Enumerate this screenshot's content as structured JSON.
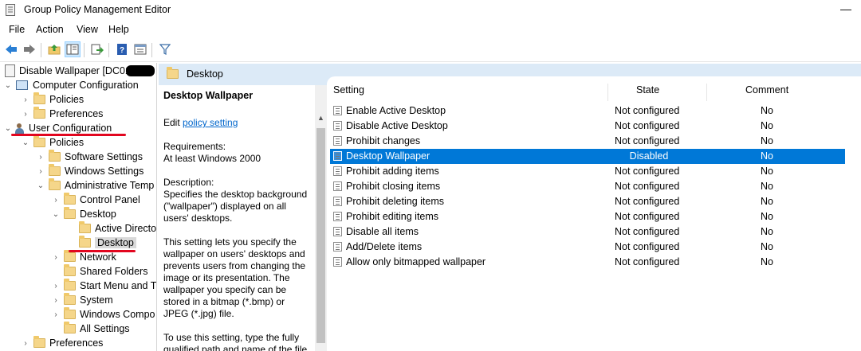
{
  "window": {
    "title": "Group Policy Management Editor",
    "minimize_glyph": "—"
  },
  "menu": [
    "File",
    "Action",
    "View",
    "Help"
  ],
  "toolbar_icons": [
    "back-arrow-icon",
    "forward-arrow-icon",
    "up-folder-icon",
    "show-hide-tree-icon",
    "export-list-icon",
    "help-icon",
    "properties-icon",
    "filter-icon"
  ],
  "tree": {
    "root": "Disable Wallpaper [DC01",
    "nodes": [
      {
        "label": "Computer Configuration"
      },
      {
        "label": "Policies"
      },
      {
        "label": "Preferences"
      },
      {
        "label": "User Configuration"
      },
      {
        "label": "Policies"
      },
      {
        "label": "Software Settings"
      },
      {
        "label": "Windows Settings"
      },
      {
        "label": "Administrative Temp"
      },
      {
        "label": "Control Panel"
      },
      {
        "label": "Desktop"
      },
      {
        "label": "Active Directo"
      },
      {
        "label": "Desktop"
      },
      {
        "label": "Network"
      },
      {
        "label": "Shared Folders"
      },
      {
        "label": "Start Menu and T"
      },
      {
        "label": "System"
      },
      {
        "label": "Windows Compo"
      },
      {
        "label": "All Settings"
      },
      {
        "label": "Preferences"
      }
    ]
  },
  "header": {
    "folder": "Desktop"
  },
  "description": {
    "title": "Desktop Wallpaper",
    "edit_prefix": "Edit",
    "edit_link": "policy setting",
    "requirements_label": "Requirements:",
    "requirements": "At least Windows 2000",
    "desc_label": "Description:",
    "desc1": "Specifies the desktop background (\"wallpaper\") displayed on all users' desktops.",
    "desc2": "This setting lets you specify the wallpaper on users' desktops and prevents users from changing the image or its presentation. The wallpaper you specify can be stored in a bitmap (*.bmp) or JPEG (*.jpg) file.",
    "desc3": "To use this setting, type the fully qualified path and name of the file"
  },
  "list": {
    "columns": [
      "Setting",
      "State",
      "Comment"
    ],
    "rows": [
      {
        "setting": "Enable Active Desktop",
        "state": "Not configured",
        "comment": "No"
      },
      {
        "setting": "Disable Active Desktop",
        "state": "Not configured",
        "comment": "No"
      },
      {
        "setting": "Prohibit changes",
        "state": "Not configured",
        "comment": "No"
      },
      {
        "setting": "Desktop Wallpaper",
        "state": "Disabled",
        "comment": "No"
      },
      {
        "setting": "Prohibit adding items",
        "state": "Not configured",
        "comment": "No"
      },
      {
        "setting": "Prohibit closing items",
        "state": "Not configured",
        "comment": "No"
      },
      {
        "setting": "Prohibit deleting items",
        "state": "Not configured",
        "comment": "No"
      },
      {
        "setting": "Prohibit editing items",
        "state": "Not configured",
        "comment": "No"
      },
      {
        "setting": "Disable all items",
        "state": "Not configured",
        "comment": "No"
      },
      {
        "setting": "Add/Delete items",
        "state": "Not configured",
        "comment": "No"
      },
      {
        "setting": "Allow only bitmapped wallpaper",
        "state": "Not configured",
        "comment": "No"
      }
    ]
  },
  "colors": {
    "selection": "#0078d7",
    "annotation": "#e2061f",
    "header_strip": "#dceaf7"
  }
}
